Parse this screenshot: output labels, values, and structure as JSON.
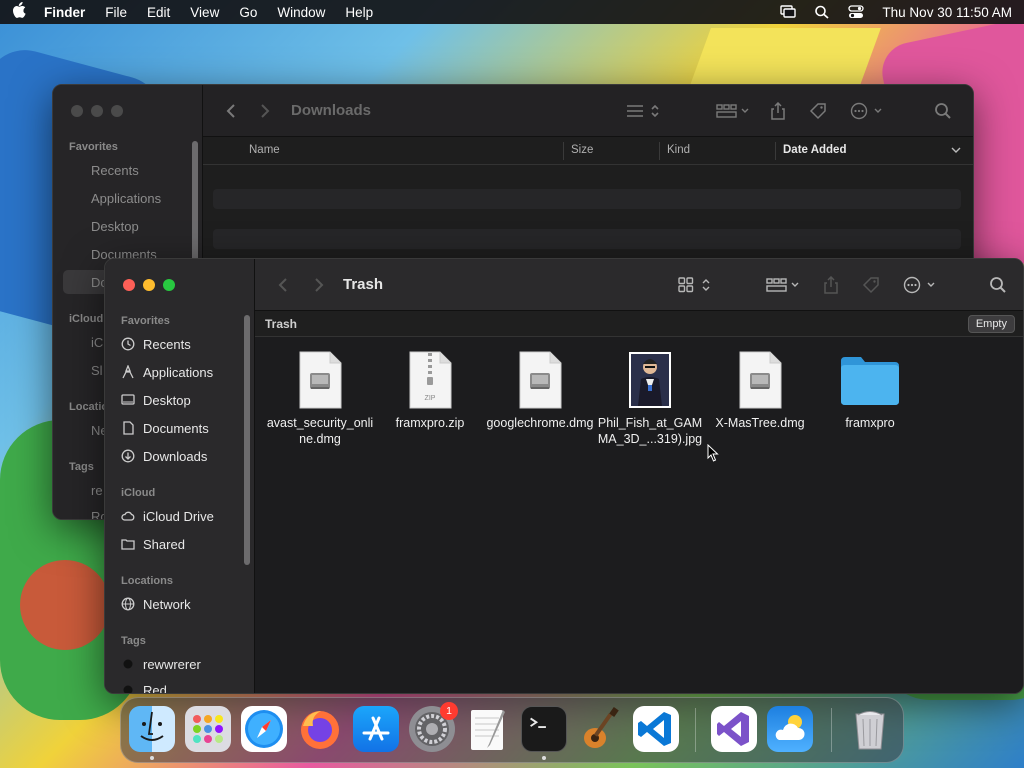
{
  "menubar": {
    "app": "Finder",
    "items": [
      "File",
      "Edit",
      "View",
      "Go",
      "Window",
      "Help"
    ],
    "clock": "Thu Nov 30  11:50 AM"
  },
  "back_window": {
    "title": "Downloads",
    "sidebar": {
      "favorites_header": "Favorites",
      "items": [
        "Recents",
        "Applications",
        "Desktop",
        "Documents",
        "Do"
      ],
      "icloud_header": "iCloud",
      "icloud_items": [
        "iC",
        "Sl"
      ],
      "locations_header": "Locatio",
      "location_items": [
        "Ne"
      ],
      "tags_header": "Tags",
      "tag_items": [
        "re",
        "Ro"
      ]
    },
    "columns": [
      "Name",
      "Size",
      "Kind",
      "Date Added"
    ]
  },
  "front_window": {
    "title": "Trash",
    "path_label": "Trash",
    "empty_button": "Empty",
    "sidebar": {
      "favorites_header": "Favorites",
      "favorites": [
        "Recents",
        "Applications",
        "Desktop",
        "Documents",
        "Downloads"
      ],
      "icloud_header": "iCloud",
      "icloud": [
        "iCloud Drive",
        "Shared"
      ],
      "locations_header": "Locations",
      "locations": [
        "Network"
      ],
      "tags_header": "Tags",
      "tags": [
        "rewwrerer",
        "Red"
      ]
    },
    "files": [
      {
        "name": "avast_security_online.dmg",
        "icon": "dmg-file-icon"
      },
      {
        "name": "framxpro.zip",
        "icon": "zip-file-icon",
        "badge": "ZIP"
      },
      {
        "name": "googlechrome.dmg",
        "icon": "dmg-file-icon"
      },
      {
        "name": "Phil_Fish_at_GAMMA_3D_...319).jpg",
        "icon": "jpg-image-icon"
      },
      {
        "name": "X-MasTree.dmg",
        "icon": "dmg-file-icon"
      },
      {
        "name": "framxpro",
        "icon": "folder-icon"
      }
    ]
  },
  "dock": {
    "apps": [
      "Finder",
      "Launchpad",
      "Safari",
      "Firefox",
      "App Store",
      "System Settings",
      "TextEdit",
      "Terminal",
      "GarageBand",
      "Visual Studio Code",
      "Visual Studio",
      "Weather",
      "Trash"
    ],
    "settings_badge": "1"
  },
  "colors": {
    "close": "#fe5f57",
    "minimize": "#febc2e",
    "zoom": "#28c840",
    "folder": "#3aa8e8"
  }
}
